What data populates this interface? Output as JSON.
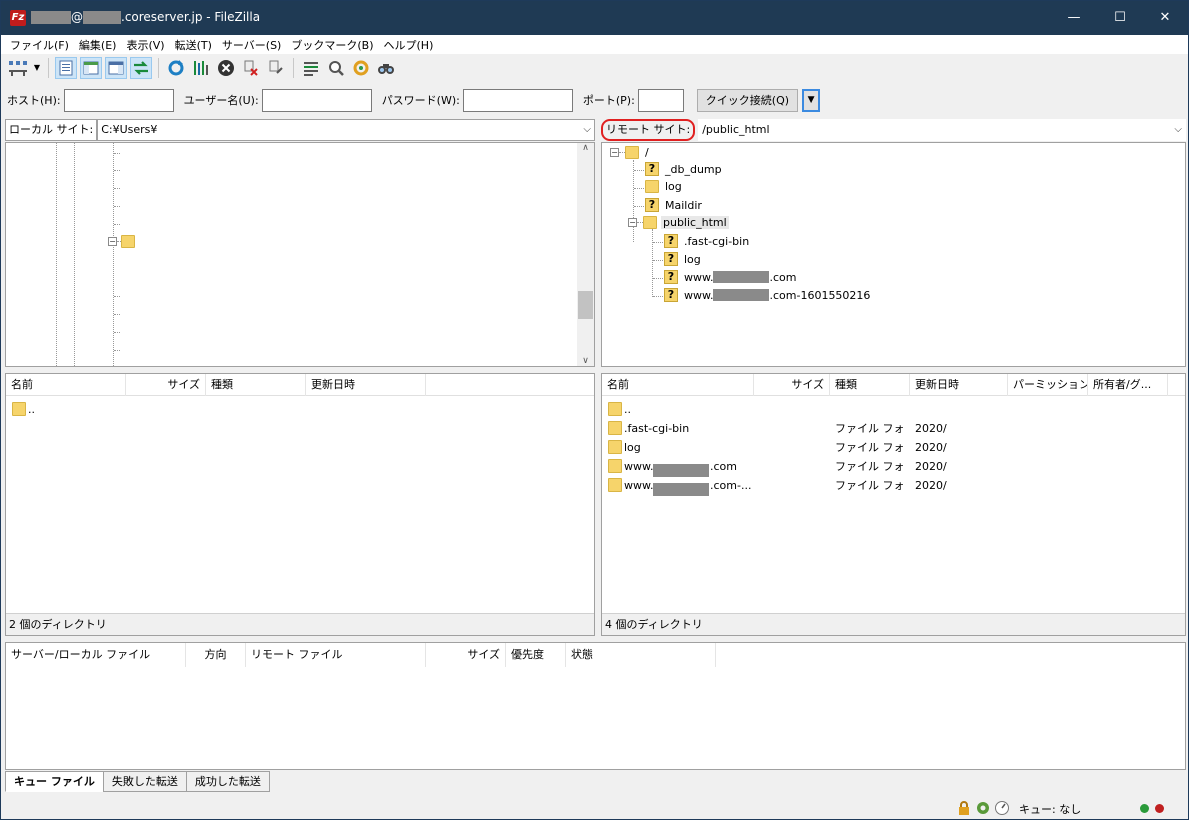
{
  "window": {
    "title_user": "",
    "title_at": "@",
    "title_host_suffix": ".coreserver.jp - FileZilla",
    "app_icon": "filezilla-logo",
    "minimize_glyph": "—",
    "maximize_glyph": "☐",
    "close_glyph": "✕"
  },
  "menu": {
    "items": [
      "ファイル(F)",
      "編集(E)",
      "表示(V)",
      "転送(T)",
      "サーバー(S)",
      "ブックマーク(B)",
      "ヘルプ(H)"
    ]
  },
  "toolbar": {
    "icons": [
      "site-manager-icon",
      "dropdown-arrow-icon",
      "toggle-message-log-icon",
      "toggle-local-tree-icon",
      "toggle-remote-tree-icon",
      "toggle-queue-icon",
      "refresh-icon",
      "process-queue-icon",
      "cancel-icon",
      "disconnect-icon",
      "reconnect-icon",
      "directory-filter-icon",
      "compare-icon",
      "sync-browse-icon",
      "search-icon"
    ]
  },
  "quickconnect": {
    "host_label": "ホスト(H):",
    "host_value": "",
    "user_label": "ユーザー名(U):",
    "user_value": "",
    "password_label": "パスワード(W):",
    "password_value": "",
    "port_label": "ポート(P):",
    "port_value": "",
    "connect_button": "クイック接続(Q)",
    "dropdown_glyph": "▼"
  },
  "local": {
    "site_label": "ローカル サイト:",
    "path": "C:¥Users¥",
    "columns": [
      "名前",
      "サイズ",
      "種類",
      "更新日時"
    ],
    "files": [
      {
        "name": "..",
        "size": "",
        "type": "",
        "modified": ""
      }
    ],
    "status": "2 個のディレクトリ"
  },
  "remote": {
    "site_label": "リモート サイト:",
    "path": "/public_html",
    "tree": {
      "root": "/",
      "children": [
        "_db_dump",
        "log",
        "Maildir",
        "public_html"
      ],
      "public_html_children": [
        ".fast-cgi-bin",
        "log",
        "www.",
        "www."
      ],
      "www_suffix_1": ".com",
      "www_suffix_2": ".com-1601550216"
    },
    "columns": [
      "名前",
      "サイズ",
      "種類",
      "更新日時",
      "パーミッション",
      "所有者/グ..."
    ],
    "files": [
      {
        "name": "..",
        "size": "",
        "type": "",
        "modified": ""
      },
      {
        "name": ".fast-cgi-bin",
        "size": "",
        "type": "ファイル フォ...",
        "modified": "2020/"
      },
      {
        "name": "log",
        "size": "",
        "type": "ファイル フォ...",
        "modified": "2020/"
      },
      {
        "name": "www.",
        "suffix": ".com",
        "size": "",
        "type": "ファイル フォ...",
        "modified": "2020/"
      },
      {
        "name": "www.",
        "suffix": ".com-...",
        "size": "",
        "type": "ファイル フォ...",
        "modified": "2020/"
      }
    ],
    "status": "4 個のディレクトリ"
  },
  "queue": {
    "columns": [
      "サーバー/ローカル ファイル",
      "方向",
      "リモート ファイル",
      "サイズ",
      "優先度",
      "状態"
    ],
    "tabs": [
      "キュー ファイル",
      "失敗した転送",
      "成功した転送"
    ]
  },
  "statusbar": {
    "queue_label": "キュー: なし",
    "icons": [
      "lock-icon",
      "settings-icon",
      "speed-limit-icon",
      "green-led-icon",
      "red-led-icon"
    ]
  },
  "colors": {
    "titlebar": "#1f3a54",
    "highlight_circle": "#e02020"
  }
}
